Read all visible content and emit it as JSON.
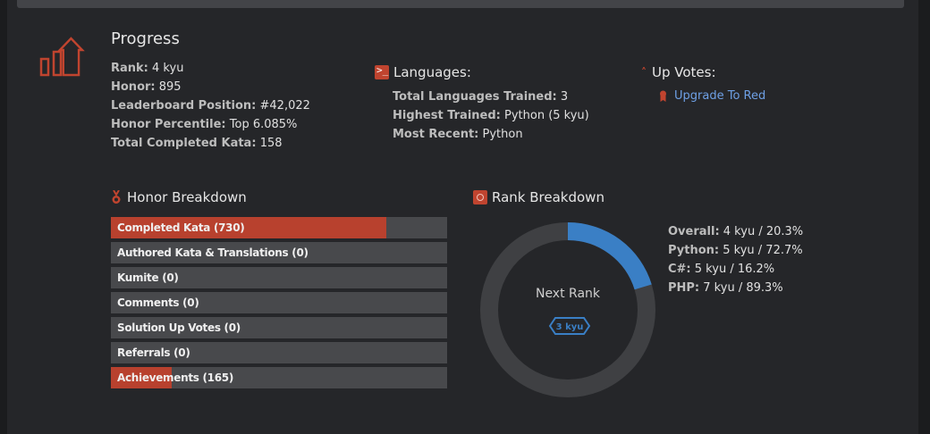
{
  "progress": {
    "title": "Progress",
    "stats": [
      {
        "key": "Rank:",
        "value": "4 kyu"
      },
      {
        "key": "Honor:",
        "value": "895"
      },
      {
        "key": "Leaderboard Position:",
        "value": "#42,022"
      },
      {
        "key": "Honor Percentile:",
        "value": "Top 6.085%"
      },
      {
        "key": "Total Completed Kata:",
        "value": "158"
      }
    ]
  },
  "languages": {
    "title": "Languages:",
    "rows": [
      {
        "key": "Total Languages Trained:",
        "value": "3"
      },
      {
        "key": "Highest Trained:",
        "value": "Python (5 kyu)"
      },
      {
        "key": "Most Recent:",
        "value": "Python"
      }
    ]
  },
  "upvotes": {
    "title": "Up Votes:",
    "link": "Upgrade To Red"
  },
  "honor_breakdown": {
    "title": "Honor Breakdown",
    "bars": [
      {
        "label": "Completed Kata (730)",
        "fill": 0.82
      },
      {
        "label": "Authored Kata & Translations (0)",
        "fill": 0
      },
      {
        "label": "Kumite (0)",
        "fill": 0
      },
      {
        "label": "Comments (0)",
        "fill": 0
      },
      {
        "label": "Solution Up Votes (0)",
        "fill": 0
      },
      {
        "label": "Referrals (0)",
        "fill": 0
      },
      {
        "label": "Achievements (165)",
        "fill": 0.18
      }
    ]
  },
  "rank_breakdown": {
    "title": "Rank Breakdown",
    "donut_label": "Next Rank",
    "next_rank": "3 kyu",
    "progress": 0.203,
    "rows": [
      {
        "key": "Overall:",
        "value": "4 kyu / 20.3%"
      },
      {
        "key": "Python:",
        "value": "5 kyu / 72.7%"
      },
      {
        "key": "C#:",
        "value": "5 kyu / 16.2%"
      },
      {
        "key": "PHP:",
        "value": "7 kyu / 89.3%"
      }
    ]
  },
  "colors": {
    "accent_red": "#c0442f",
    "rank_blue": "#3a7fc5",
    "link_blue": "#6ea0e5"
  }
}
